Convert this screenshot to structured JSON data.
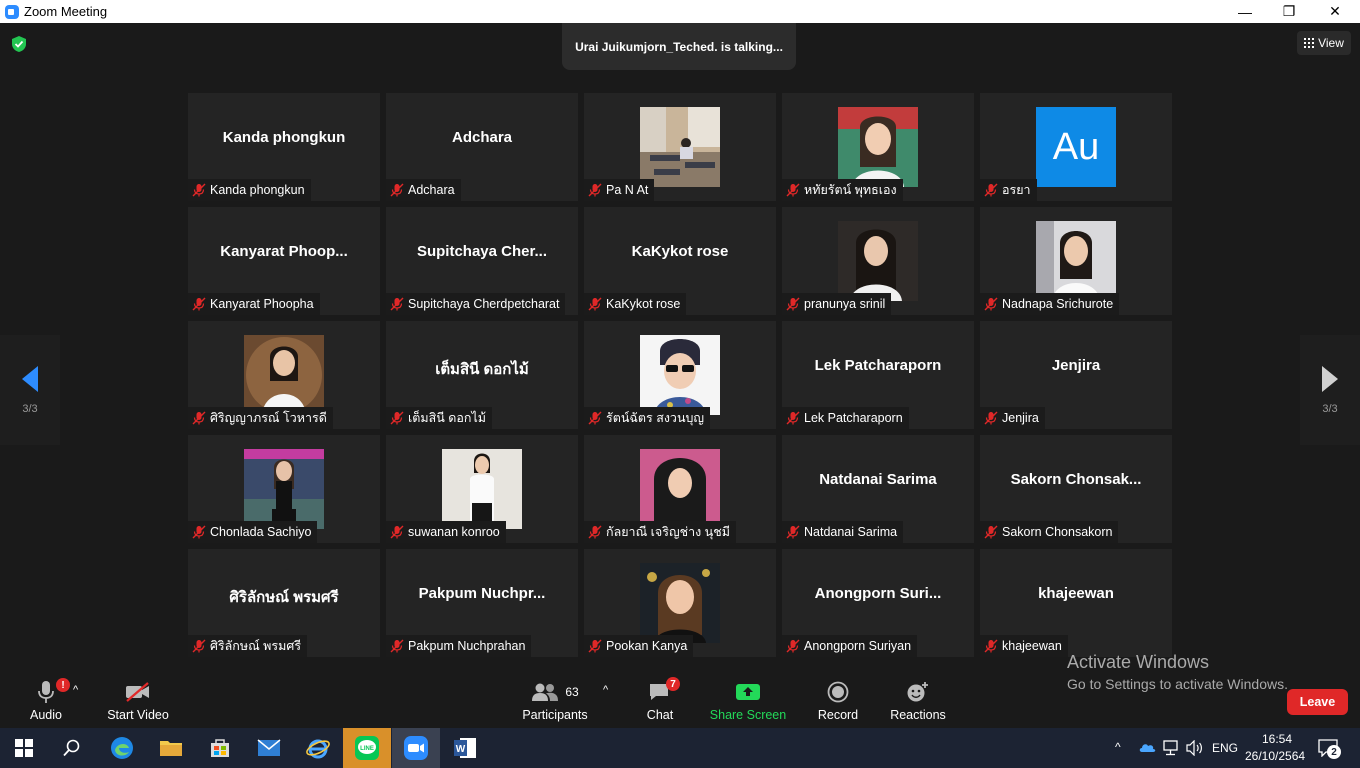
{
  "window": {
    "title": "Zoom Meeting",
    "min": "—",
    "max": "❐",
    "close": "✕"
  },
  "meeting": {
    "talking_banner": "Urai Juikumjorn_Teched. is talking...",
    "view_label": "View",
    "page_left": "3/3",
    "page_right": "3/3"
  },
  "tiles": [
    {
      "center": "Kanda phongkun",
      "label": "Kanda phongkun",
      "video": false
    },
    {
      "center": "Adchara",
      "label": "Adchara",
      "video": false
    },
    {
      "center": "",
      "label": "Pa N At",
      "video": true,
      "photo": "classroom"
    },
    {
      "center": "",
      "label": "หทัยรัตน์ พุทธเอง",
      "video": true,
      "photo": "girl1"
    },
    {
      "center": "",
      "label": "อรยา",
      "video": false,
      "avatar": "Au"
    },
    {
      "center": "Kanyarat  Phoop...",
      "label": "Kanyarat Phoopha",
      "video": false
    },
    {
      "center": "Supitchaya  Cher...",
      "label": "Supitchaya Cherdpetcharat",
      "video": false
    },
    {
      "center": "KaKykot rose",
      "label": "KaKykot rose",
      "video": false
    },
    {
      "center": "",
      "label": "pranunya srinil",
      "video": true,
      "photo": "girl2"
    },
    {
      "center": "",
      "label": "Nadnapa Srichurote",
      "video": true,
      "photo": "girl3"
    },
    {
      "center": "",
      "label": "ศิริญญาภรณ์ โวหารดี",
      "video": true,
      "photo": "girl4"
    },
    {
      "center": "เต็มสินี ดอกไม้",
      "label": "เต็มสินี ดอกไม้",
      "video": false
    },
    {
      "center": "",
      "label": "รัตน์ฉัตร สงวนบุญ",
      "video": true,
      "photo": "girl5"
    },
    {
      "center": "Lek Patcharaporn",
      "label": "Lek Patcharaporn",
      "video": false
    },
    {
      "center": "Jenjira",
      "label": "Jenjira",
      "video": false
    },
    {
      "center": "",
      "label": "Chonlada Sachiyo",
      "video": true,
      "photo": "girl6"
    },
    {
      "center": "",
      "label": "suwanan konroo",
      "video": true,
      "photo": "girl7"
    },
    {
      "center": "",
      "label": "กัลยาณี เจริญช่าง นุชมี",
      "video": true,
      "photo": "girl8"
    },
    {
      "center": "Natdanai Sarima",
      "label": "Natdanai Sarima",
      "video": false
    },
    {
      "center": "Sakorn  Chonsak...",
      "label": "Sakorn Chonsakorn",
      "video": false
    },
    {
      "center": "ศิริลักษณ์ พรมศรี",
      "label": "ศิริลักษณ์ พรมศรี",
      "video": false
    },
    {
      "center": "Pakpum  Nuchpr...",
      "label": "Pakpum Nuchprahan",
      "video": false
    },
    {
      "center": "",
      "label": "Pookan Kanya",
      "video": true,
      "photo": "girl9"
    },
    {
      "center": "Anongporn  Suri...",
      "label": "Anongporn Suriyan",
      "video": false
    },
    {
      "center": "khajeewan",
      "label": "khajeewan",
      "video": false
    }
  ],
  "toolbar": {
    "audio_label": "Audio",
    "audio_badge": "!",
    "video_label": "Start Video",
    "participants_label": "Participants",
    "participants_count": "63",
    "chat_label": "Chat",
    "chat_badge": "7",
    "share_label": "Share Screen",
    "record_label": "Record",
    "reactions_label": "Reactions",
    "leave_label": "Leave"
  },
  "activate": {
    "line1": "Activate Windows",
    "line2": "Go to Settings to activate Windows."
  },
  "taskbar": {
    "lang": "ENG",
    "time": "16:54",
    "date": "26/10/2564",
    "notif_count": "2"
  },
  "colors": {
    "accent_share": "#23d959",
    "leave": "#e02828",
    "avatar_bg": "#0e8ae6"
  }
}
